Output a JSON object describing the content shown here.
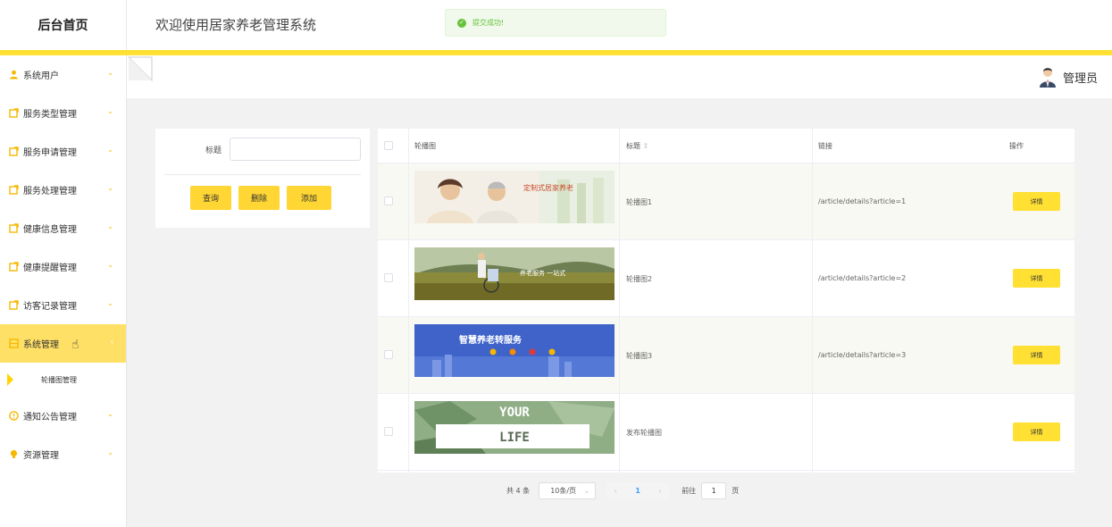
{
  "header": {
    "brand": "后台首页",
    "system_title": "欢迎使用居家养老管理系统",
    "toast": "提交成功!",
    "user": "管理员"
  },
  "colors": {
    "accent": "#ffe033",
    "active_menu": "#ffe066",
    "success": "#67c23a",
    "link_blue": "#409eff"
  },
  "sidebar": {
    "items": [
      {
        "label": "系统用户",
        "icon": "user-icon"
      },
      {
        "label": "服务类型管理",
        "icon": "edit-icon"
      },
      {
        "label": "服务申请管理",
        "icon": "edit-icon"
      },
      {
        "label": "服务处理管理",
        "icon": "edit-icon"
      },
      {
        "label": "健康信息管理",
        "icon": "edit-icon"
      },
      {
        "label": "健康提醒管理",
        "icon": "edit-icon"
      },
      {
        "label": "访客记录管理",
        "icon": "edit-icon"
      },
      {
        "label": "系统管理",
        "icon": "grid-icon",
        "active": true
      },
      {
        "label": "通知公告管理",
        "icon": "info-icon"
      },
      {
        "label": "资源管理",
        "icon": "bulb-icon"
      }
    ],
    "sub_item": "轮播图管理"
  },
  "search": {
    "label": "标题",
    "value": "",
    "buttons": {
      "query": "查询",
      "delete": "删除",
      "add": "添加"
    }
  },
  "table": {
    "headers": {
      "image": "轮播图",
      "title": "标题",
      "link": "链接",
      "action": "操作"
    },
    "rows": [
      {
        "title": "轮播图1",
        "link": "/article/details?article=1",
        "action": "详情",
        "image": "elderly-couple-banner",
        "banner_text": "定制式居家养老"
      },
      {
        "title": "轮播图2",
        "link": "/article/details?article=2",
        "action": "详情",
        "image": "wheelchair-field-banner",
        "banner_text": "养老服务 一站式"
      },
      {
        "title": "轮播图3",
        "link": "/article/details?article=3",
        "action": "详情",
        "image": "smart-elderly-city-banner",
        "banner_text": "智慧养老转服务"
      },
      {
        "title": "发布轮播图",
        "link": "",
        "action": "详情",
        "image": "your-life-banner",
        "banner_text": "YOUR LIFE"
      }
    ]
  },
  "pagination": {
    "total": "共 4 条",
    "page_size": "10条/页",
    "current": "1",
    "goto_label": "前往",
    "goto_value": "1",
    "goto_suffix": "页"
  }
}
